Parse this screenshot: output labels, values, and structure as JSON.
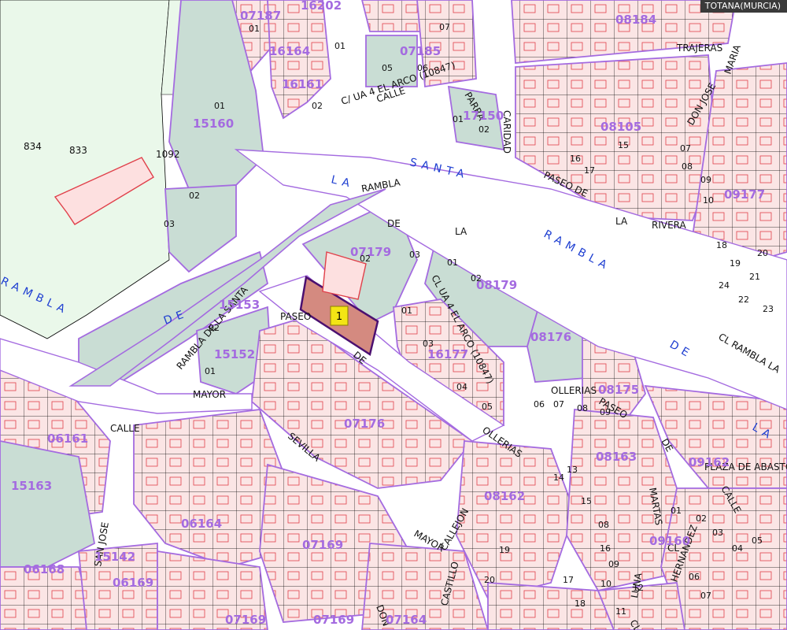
{
  "title": "TOTANA(MURCIA)",
  "colors": {
    "block_fill": "#c9ddd4",
    "block_stroke": "#a46be0",
    "parcel_fill": "#fbe5e5",
    "parcel_line": "#000000",
    "building_line": "#e0404a",
    "street_label": "#1f3fd1",
    "block_id": "#a46be0",
    "green_area": "#eaf8ea",
    "highlight_fill": "#d48a80",
    "highlight_stroke": "#4b1070",
    "marker_fill": "#f3e514"
  },
  "highlight": {
    "label": "1"
  },
  "street_labels": [
    {
      "text": "LA",
      "size": 14,
      "angle": 13
    },
    {
      "text": "SANTA",
      "size": 14,
      "angle": 13
    },
    {
      "text": "RAMBLA",
      "size": 14,
      "angle": 28
    },
    {
      "text": "RAMBLA",
      "size": 14,
      "angle": 25
    },
    {
      "text": "DE",
      "size": 14,
      "angle": -20
    },
    {
      "text": "DE",
      "size": 14,
      "angle": 30
    },
    {
      "text": "LA",
      "size": 14,
      "angle": 30
    }
  ],
  "black_labels": [
    {
      "text": "RAMBLA",
      "angle": -10
    },
    {
      "text": "DE",
      "angle": 0
    },
    {
      "text": "LA",
      "angle": 0
    },
    {
      "text": "CL UA 4 EL ARCO (10847)",
      "angle": 62
    },
    {
      "text": "C/ UA 4 EL ARCO (10847)",
      "angle": -18
    },
    {
      "text": "PASEO",
      "angle": 0
    },
    {
      "text": "DE",
      "angle": 40
    },
    {
      "text": "MAYOR",
      "angle": 0
    },
    {
      "text": "SEVILLA",
      "angle": 40
    },
    {
      "text": "MAYOR",
      "angle": 30
    },
    {
      "text": "RAMBLA DE LA SANTA",
      "angle": -50
    },
    {
      "text": "CALLE",
      "angle": 0
    },
    {
      "text": "CALLE",
      "angle": -18
    },
    {
      "text": "OLLERIAS",
      "angle": 35
    },
    {
      "text": "OLLERIAS",
      "angle": 0
    },
    {
      "text": "PASEO",
      "angle": 30
    },
    {
      "text": "CARIDAD",
      "angle": 90
    },
    {
      "text": "PARRA",
      "angle": 60
    },
    {
      "text": "TRAJERAS",
      "angle": 0
    },
    {
      "text": "MARIA",
      "angle": -70
    },
    {
      "text": "DON JOSE",
      "angle": -60
    },
    {
      "text": "PASEO DE",
      "angle": 25
    },
    {
      "text": "LA",
      "angle": 0
    },
    {
      "text": "RIVERA",
      "angle": 0
    },
    {
      "text": "CL RAMBLA LA",
      "angle": 30
    },
    {
      "text": "SAN JOSE",
      "angle": -80
    },
    {
      "text": "CALLEJON",
      "angle": -60
    },
    {
      "text": "CASTILLO",
      "angle": -75
    },
    {
      "text": "DE",
      "angle": 60
    },
    {
      "text": "MARTAS",
      "angle": 80
    },
    {
      "text": "PLAZA DE ABASTOS",
      "angle": 0
    },
    {
      "text": "CALLE",
      "angle": 60
    },
    {
      "text": "LUNA",
      "angle": -80
    },
    {
      "text": "CL",
      "angle": 60
    },
    {
      "text": "HERNANDEZ",
      "angle": -70
    },
    {
      "text": "CL",
      "angle": 0
    },
    {
      "text": "DON",
      "angle": 70
    },
    {
      "text": "834",
      "angle": 0
    },
    {
      "text": "833",
      "angle": 0
    },
    {
      "text": "1092",
      "angle": 0
    }
  ],
  "block_ids": [
    "07187",
    "16202",
    "16164",
    "16161",
    "15160",
    "07185",
    "17150",
    "08184",
    "08105",
    "09177",
    "07179",
    "08179",
    "08176",
    "15153",
    "15152",
    "07176",
    "16177",
    "08175",
    "06161",
    "15163",
    "06164",
    "07169",
    "08162",
    "08163",
    "09162",
    "09160",
    "06168",
    "15142",
    "06169",
    "07169",
    "07169",
    "07164"
  ],
  "parcel_numbers": [
    "01",
    "01",
    "02",
    "01",
    "02",
    "03",
    "02",
    "01",
    "05",
    "06",
    "07",
    "01",
    "02",
    "01",
    "02",
    "03",
    "02",
    "01",
    "03",
    "04",
    "05",
    "06",
    "07",
    "08",
    "09",
    "07",
    "08",
    "09",
    "10",
    "15",
    "16",
    "17",
    "18",
    "19",
    "20",
    "21",
    "22",
    "23",
    "24",
    "01",
    "02",
    "03",
    "04",
    "05",
    "06",
    "07",
    "08",
    "09",
    "10",
    "11",
    "12",
    "13",
    "14",
    "15",
    "16",
    "17",
    "18",
    "19",
    "20"
  ]
}
